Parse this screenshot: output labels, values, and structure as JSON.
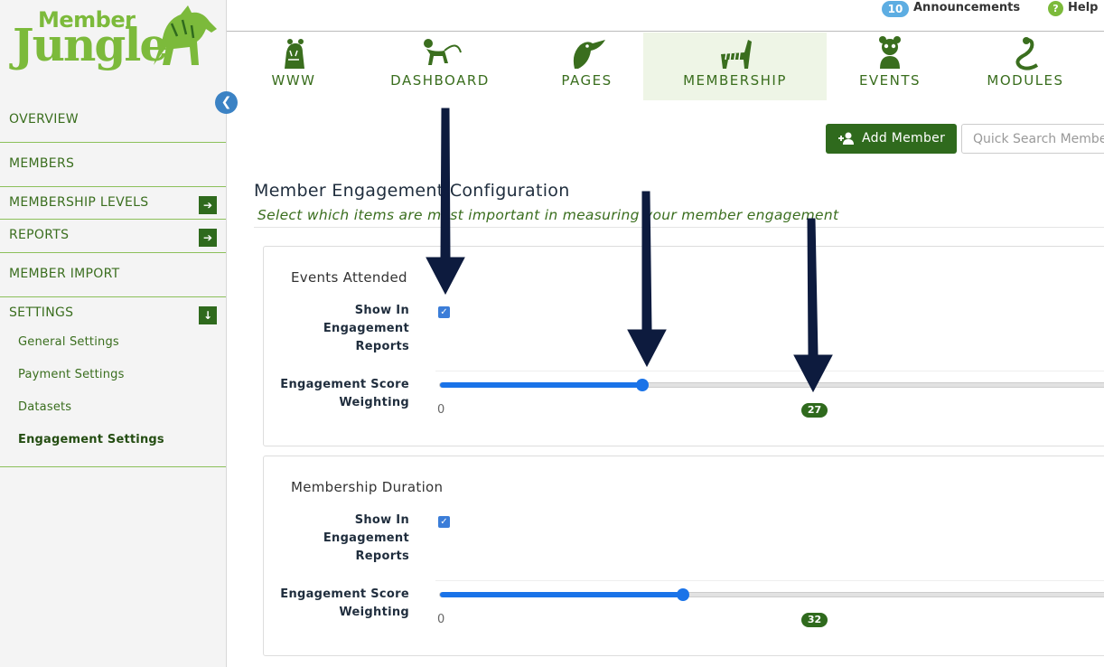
{
  "logo": {
    "member": "Member",
    "jungle": "Jungle"
  },
  "topbar": {
    "announcement_count": "10",
    "announcements_label": "Announcements",
    "help_label": "Help"
  },
  "tabs": [
    {
      "label": "WWW",
      "icon": "tiger-icon",
      "active": false
    },
    {
      "label": "DASHBOARD",
      "icon": "monkey-icon",
      "active": false
    },
    {
      "label": "PAGES",
      "icon": "toucan-icon",
      "active": false
    },
    {
      "label": "MEMBERSHIP",
      "icon": "zebra-icon",
      "active": true
    },
    {
      "label": "EVENTS",
      "icon": "panda-icon",
      "active": false
    },
    {
      "label": "MODULES",
      "icon": "snake-icon",
      "active": false
    }
  ],
  "sidebar": {
    "items": [
      {
        "label": "OVERVIEW"
      },
      {
        "label": "MEMBERS"
      },
      {
        "label": "MEMBERSHIP LEVELS",
        "arrow": "right"
      },
      {
        "label": "REPORTS",
        "arrow": "right"
      },
      {
        "label": "MEMBER IMPORT"
      },
      {
        "label": "SETTINGS",
        "arrow": "down"
      }
    ],
    "sub_items": [
      {
        "label": "General Settings"
      },
      {
        "label": "Payment Settings"
      },
      {
        "label": "Datasets"
      },
      {
        "label": "Engagement Settings",
        "active": true
      }
    ]
  },
  "toolbar": {
    "add_member_label": "Add Member",
    "search_placeholder": "Quick Search Members"
  },
  "page": {
    "title": "Member Engagement Configuration",
    "subtitle": "Select which items are most important in measuring your member engagement"
  },
  "cards": [
    {
      "title": "Events Attended",
      "show_label_lines": [
        "Show In",
        "Engagement",
        "Reports"
      ],
      "show_checked": true,
      "weight_label_lines": [
        "Engagement Score",
        "Weighting"
      ],
      "slider_min": "0",
      "slider_value": 0.3,
      "score": "27"
    },
    {
      "title": "Membership Duration",
      "show_label_lines": [
        "Show In",
        "Engagement",
        "Reports"
      ],
      "show_checked": true,
      "weight_label_lines": [
        "Engagement Score",
        "Weighting"
      ],
      "slider_min": "0",
      "slider_value": 0.36,
      "score": "32"
    }
  ],
  "colors": {
    "brand_green": "#2f6a1d",
    "logo_green": "#7cba3b",
    "slider_blue": "#1a73e8",
    "arrow_navy": "#0d1b3e"
  }
}
